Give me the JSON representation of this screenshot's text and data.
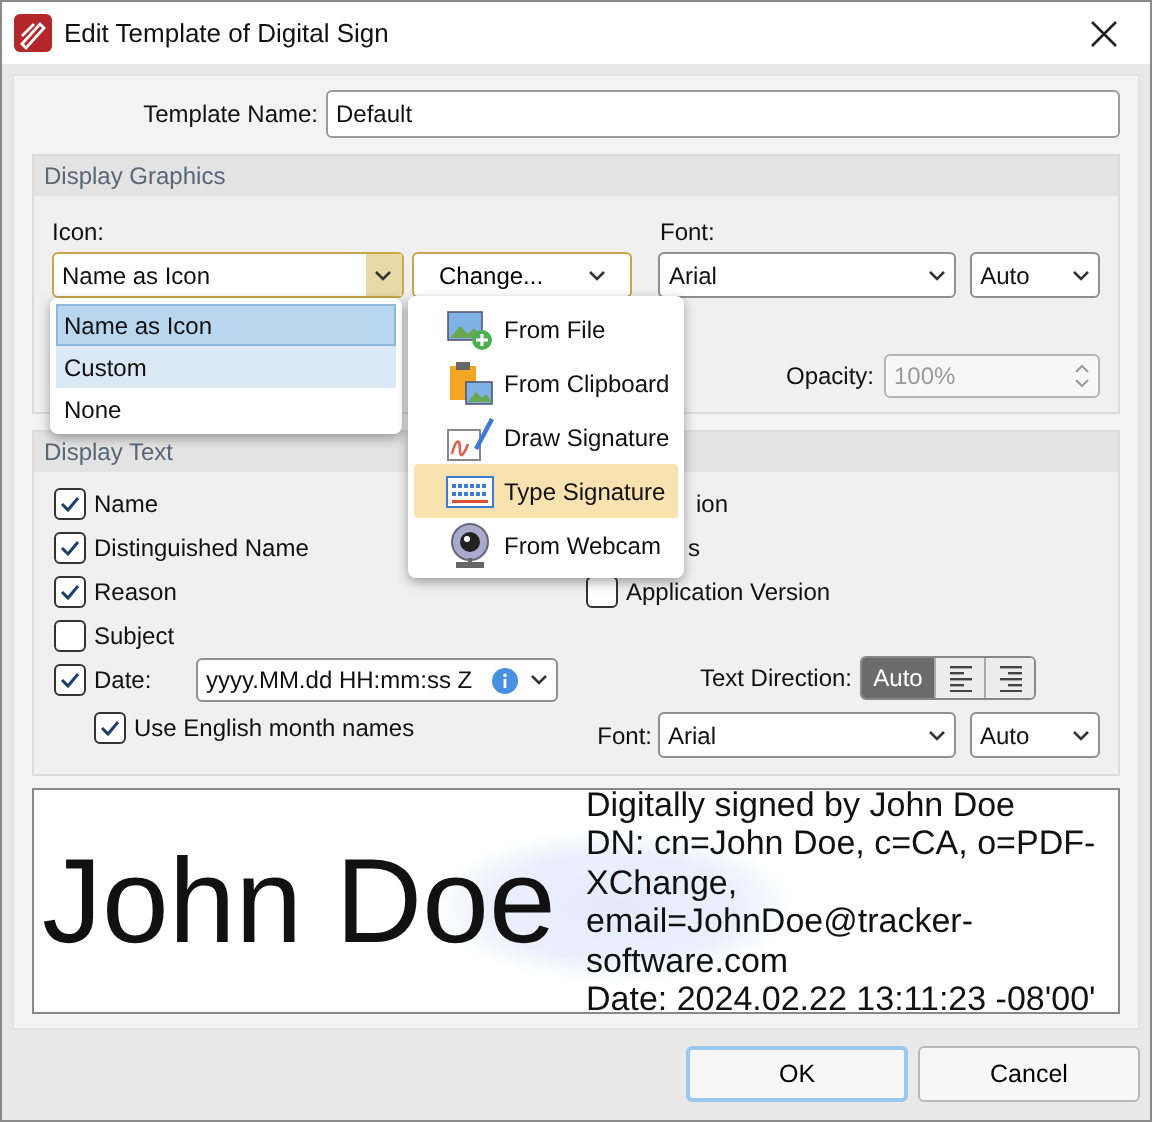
{
  "window": {
    "title": "Edit Template of Digital Sign"
  },
  "template_name": {
    "label": "Template Name:",
    "value": "Default"
  },
  "display_graphics": {
    "title": "Display Graphics",
    "icon_label": "Icon:",
    "icon_value": "Name as Icon",
    "change_button": "Change...",
    "font_label": "Font:",
    "font_value": "Arial",
    "size_value": "Auto",
    "opacity_label": "Opacity:",
    "opacity_value": "100%",
    "opacity_disabled": true
  },
  "display_text": {
    "title": "Display Text",
    "left_options": [
      {
        "label": "Name",
        "checked": true
      },
      {
        "label": "Distinguished Name",
        "checked": true
      },
      {
        "label": "Reason",
        "checked": true
      },
      {
        "label": "Subject",
        "checked": false
      },
      {
        "label": "Date:",
        "checked": true
      }
    ],
    "date_format": "yyyy.MM.dd HH:mm:ss Z",
    "english_months": {
      "label": "Use English month names",
      "checked": true
    },
    "right_options": [
      {
        "kind": "covered",
        "label": "ion"
      },
      {
        "kind": "covered",
        "label": "s"
      },
      {
        "kind": "checkbox",
        "label": "Application Version",
        "checked": false
      }
    ],
    "text_direction": {
      "label": "Text Direction:",
      "options": [
        {
          "kind": "text",
          "label": "Auto",
          "selected": true
        },
        {
          "kind": "align-left",
          "selected": false
        },
        {
          "kind": "align-right",
          "selected": false
        }
      ]
    },
    "font_label": "Font:",
    "font_value": "Arial",
    "size_value": "Auto"
  },
  "preview": {
    "name": "John Doe",
    "details": [
      "Digitally signed by John Doe",
      "DN: cn=John Doe, c=CA, o=PDF-",
      "XChange,",
      "email=JohnDoe@tracker-",
      "software.com",
      "Date: 2024.02.22 13:11:23 -08'00'"
    ]
  },
  "icon_dropdown": {
    "items": [
      {
        "label": "Name as Icon",
        "selected": true,
        "highlighted": false
      },
      {
        "label": "Custom",
        "selected": false,
        "highlighted": true
      },
      {
        "label": "None",
        "selected": false,
        "highlighted": false
      }
    ]
  },
  "change_menu": {
    "items": [
      {
        "kind": "file",
        "label": "From File",
        "highlighted": false
      },
      {
        "kind": "clipboard",
        "label": "From Clipboard",
        "highlighted": false
      },
      {
        "kind": "draw",
        "label": "Draw Signature",
        "highlighted": false
      },
      {
        "kind": "keyboard",
        "label": "Type Signature",
        "highlighted": true
      },
      {
        "kind": "webcam",
        "label": "From Webcam",
        "highlighted": false
      }
    ]
  },
  "buttons": [
    {
      "label": "OK",
      "default": true
    },
    {
      "label": "Cancel",
      "default": false
    }
  ]
}
